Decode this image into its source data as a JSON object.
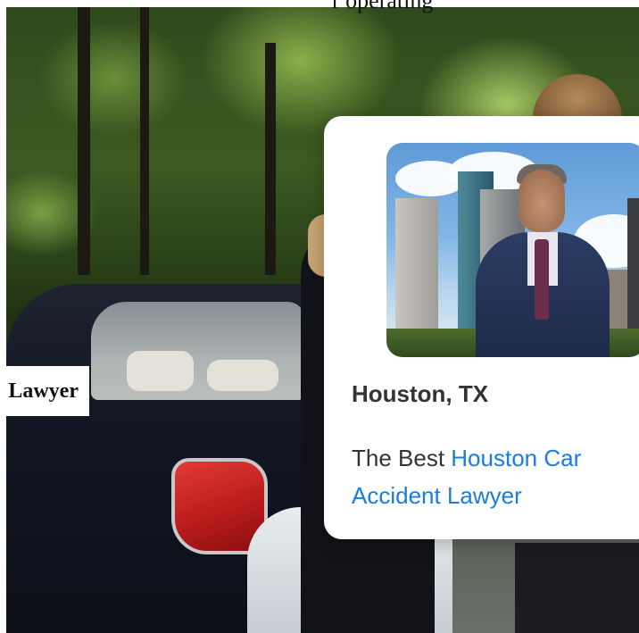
{
  "top_text": "  r  operating  ",
  "left_label": "Lawyer",
  "card": {
    "title": "Houston, TX",
    "description_prefix": "The Best ",
    "link_text": "Houston Car Accident Lawyer"
  },
  "colors": {
    "link": "#1a7ae6",
    "text": "#333333",
    "card_bg": "#ffffff"
  }
}
